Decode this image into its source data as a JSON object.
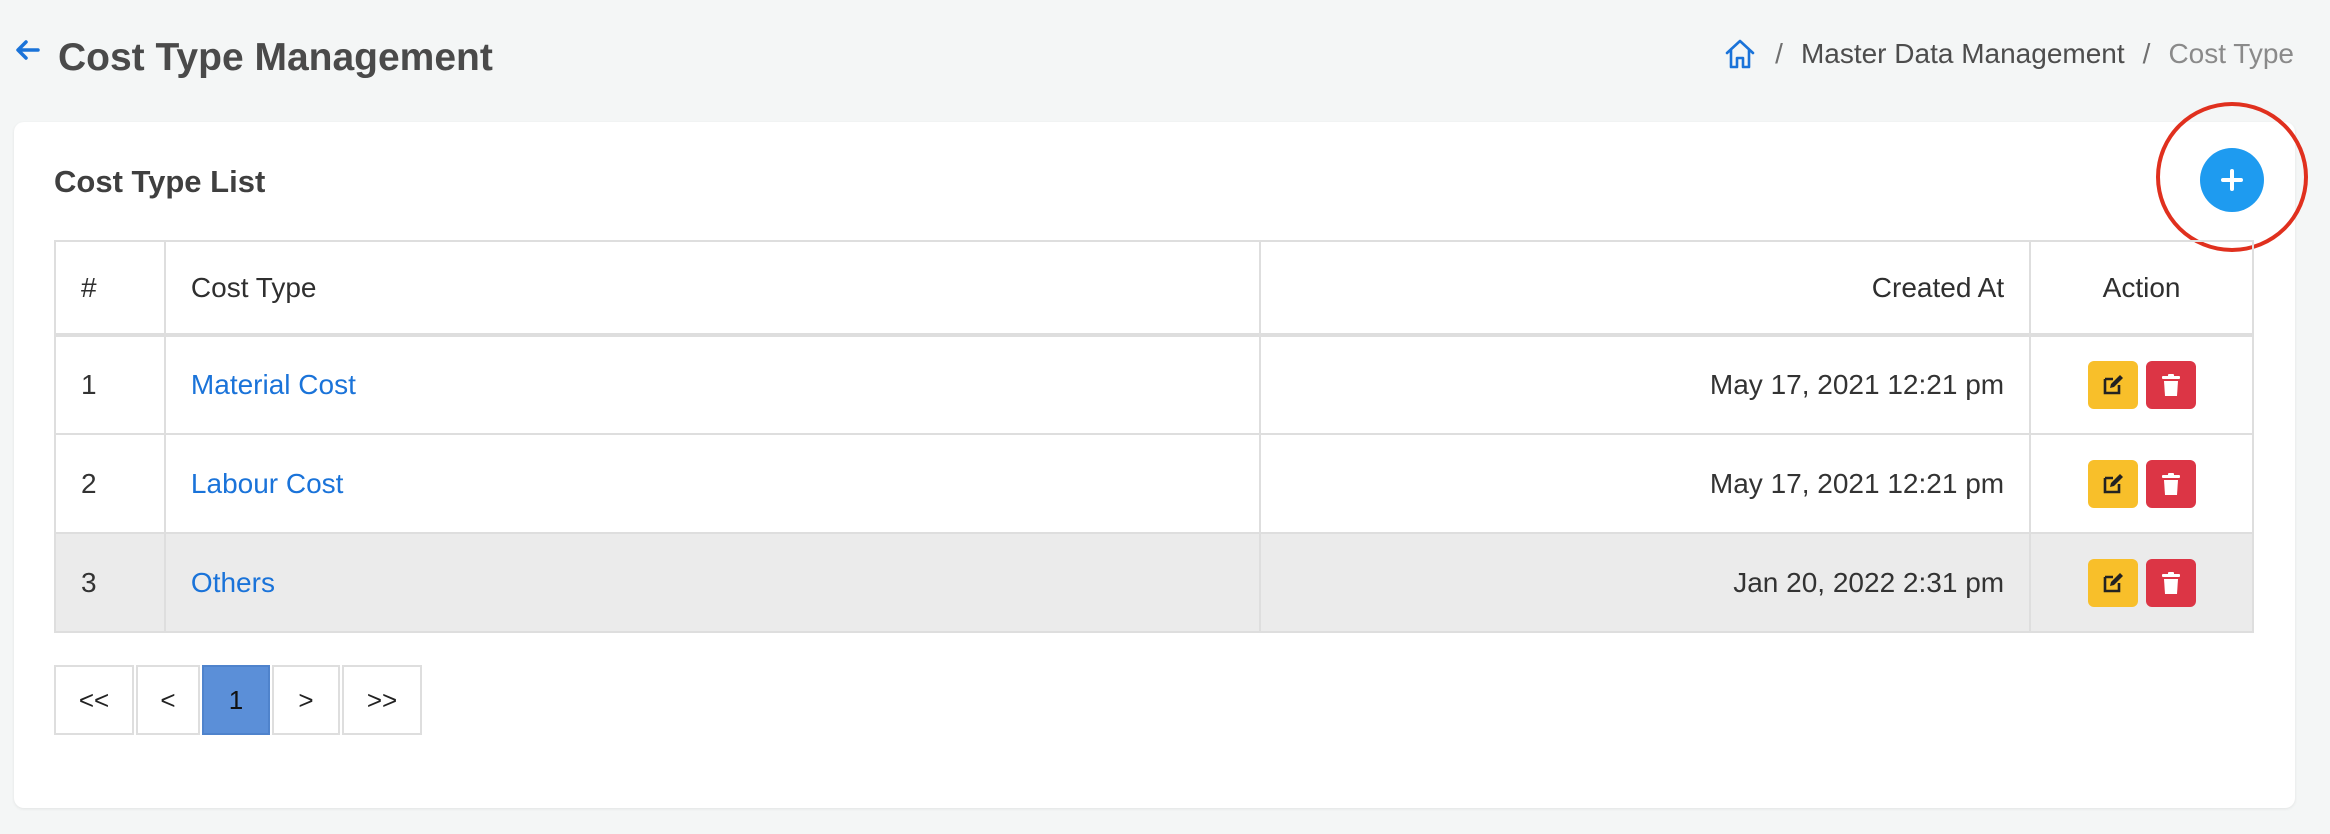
{
  "header": {
    "title": "Cost Type Management",
    "back_icon": "arrow-left-icon"
  },
  "breadcrumb": {
    "home_icon": "home-icon",
    "separator": "/",
    "items": [
      "Master Data Management",
      "Cost Type"
    ]
  },
  "card": {
    "title": "Cost Type List",
    "add_icon": "plus-icon",
    "accent_color": "#1e9bf0",
    "annotation_color": "#e0301e"
  },
  "table": {
    "columns": [
      "#",
      "Cost Type",
      "Created At",
      "Action"
    ],
    "rows": [
      {
        "num": "1",
        "cost_type": "Material Cost",
        "created_at": "May 17, 2021 12:21 pm"
      },
      {
        "num": "2",
        "cost_type": "Labour Cost",
        "created_at": "May 17, 2021 12:21 pm"
      },
      {
        "num": "3",
        "cost_type": "Others",
        "created_at": "Jan 20, 2022 2:31 pm"
      }
    ],
    "action_icons": [
      "edit-icon",
      "trash-icon"
    ],
    "edit_color": "#f8bf2a",
    "delete_color": "#dc3545",
    "link_color": "#1a73d9"
  },
  "pagination": {
    "first": "<<",
    "prev": "<",
    "current_page": "1",
    "next": ">",
    "last": ">>"
  }
}
